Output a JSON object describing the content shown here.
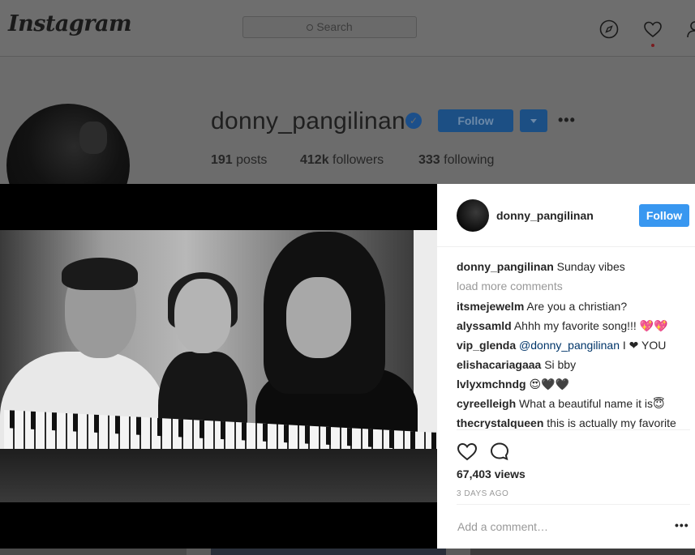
{
  "header": {
    "logo": "Instagram",
    "search_placeholder": "Search",
    "icons": [
      "compass-icon",
      "heart-icon",
      "person-icon"
    ]
  },
  "profile": {
    "username": "donny_pangilinan",
    "verified": true,
    "follow_label": "Follow",
    "stats": {
      "posts_count": "191",
      "posts_label": "posts",
      "followers_count": "412k",
      "followers_label": "followers",
      "following_count": "333",
      "following_label": "following"
    }
  },
  "post": {
    "author": "donny_pangilinan",
    "follow_label": "Follow",
    "caption_user": "donny_pangilinan",
    "caption_text": "Sunday vibes",
    "load_more": "load more comments",
    "comments": [
      {
        "user": "itsmejewelm",
        "text": "Are you a christian?"
      },
      {
        "user": "alyssamld",
        "text": "Ahhh my favorite song!!! 💖💖"
      },
      {
        "user": "vip_glenda",
        "mention": "@donny_pangilinan",
        "text": "I ❤ YOU"
      },
      {
        "user": "elishacariagaaa",
        "text": "Si bby"
      },
      {
        "user": "lvlyxmchndg",
        "text": "😍🖤🖤"
      },
      {
        "user": "cyreelleigh",
        "text": "What a beautiful name it is😇"
      },
      {
        "user": "thecrystalqueen",
        "text": "this is actually my favorite"
      }
    ],
    "views": "67,403 views",
    "time": "3 DAYS AGO",
    "add_comment_placeholder": "Add a comment…",
    "options_label": "•••"
  },
  "colors": {
    "accent": "#3897f0",
    "overlay": "#6c6c6c"
  }
}
